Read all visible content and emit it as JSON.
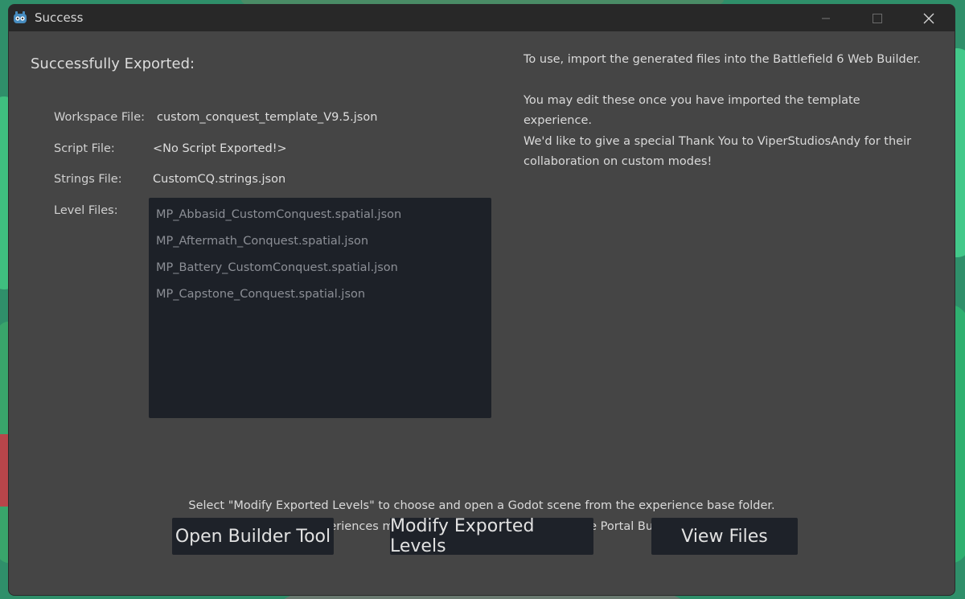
{
  "window": {
    "title": "Success"
  },
  "main": {
    "heading": "Successfully Exported:",
    "workspace_label": "Workspace File:",
    "workspace_value": "custom_conquest_template_V9.5.json",
    "script_label": "Script File:",
    "script_value": "<No Script Exported!>",
    "strings_label": "Strings File:",
    "strings_value": "CustomCQ.strings.json",
    "level_label": "Level Files:",
    "level_files": [
      "MP_Abbasid_CustomConquest.spatial.json",
      "MP_Aftermath_Conquest.spatial.json",
      "MP_Battery_CustomConquest.spatial.json",
      "MP_Capstone_Conquest.spatial.json"
    ]
  },
  "info": {
    "line1": "To use, import the generated files into the Battlefield 6 Web Builder.",
    "line2": "You may edit these once you have imported the template experience.",
    "line3": "We'd like to give a special Thank You to ViperStudiosAndy for their collaboration on custom modes!"
  },
  "footer": {
    "note1": "Select \"Modify Exported Levels\" to choose and open a Godot scene from the experience base folder.",
    "note2": "Modified experiences must be uploaded individually to the Portal Builder Tool.",
    "open_builder_label": "Open Builder Tool",
    "modify_levels_label": "Modify Exported Levels",
    "view_files_label": "View Files"
  },
  "icons": {
    "app": "godot-icon",
    "minimize": "minimize-icon",
    "maximize": "maximize-icon",
    "close": "close-icon"
  },
  "colors": {
    "window_bg": "#454545",
    "titlebar_bg": "#282828",
    "panel_bg": "#1d2128",
    "button_bg": "#1e2229"
  }
}
